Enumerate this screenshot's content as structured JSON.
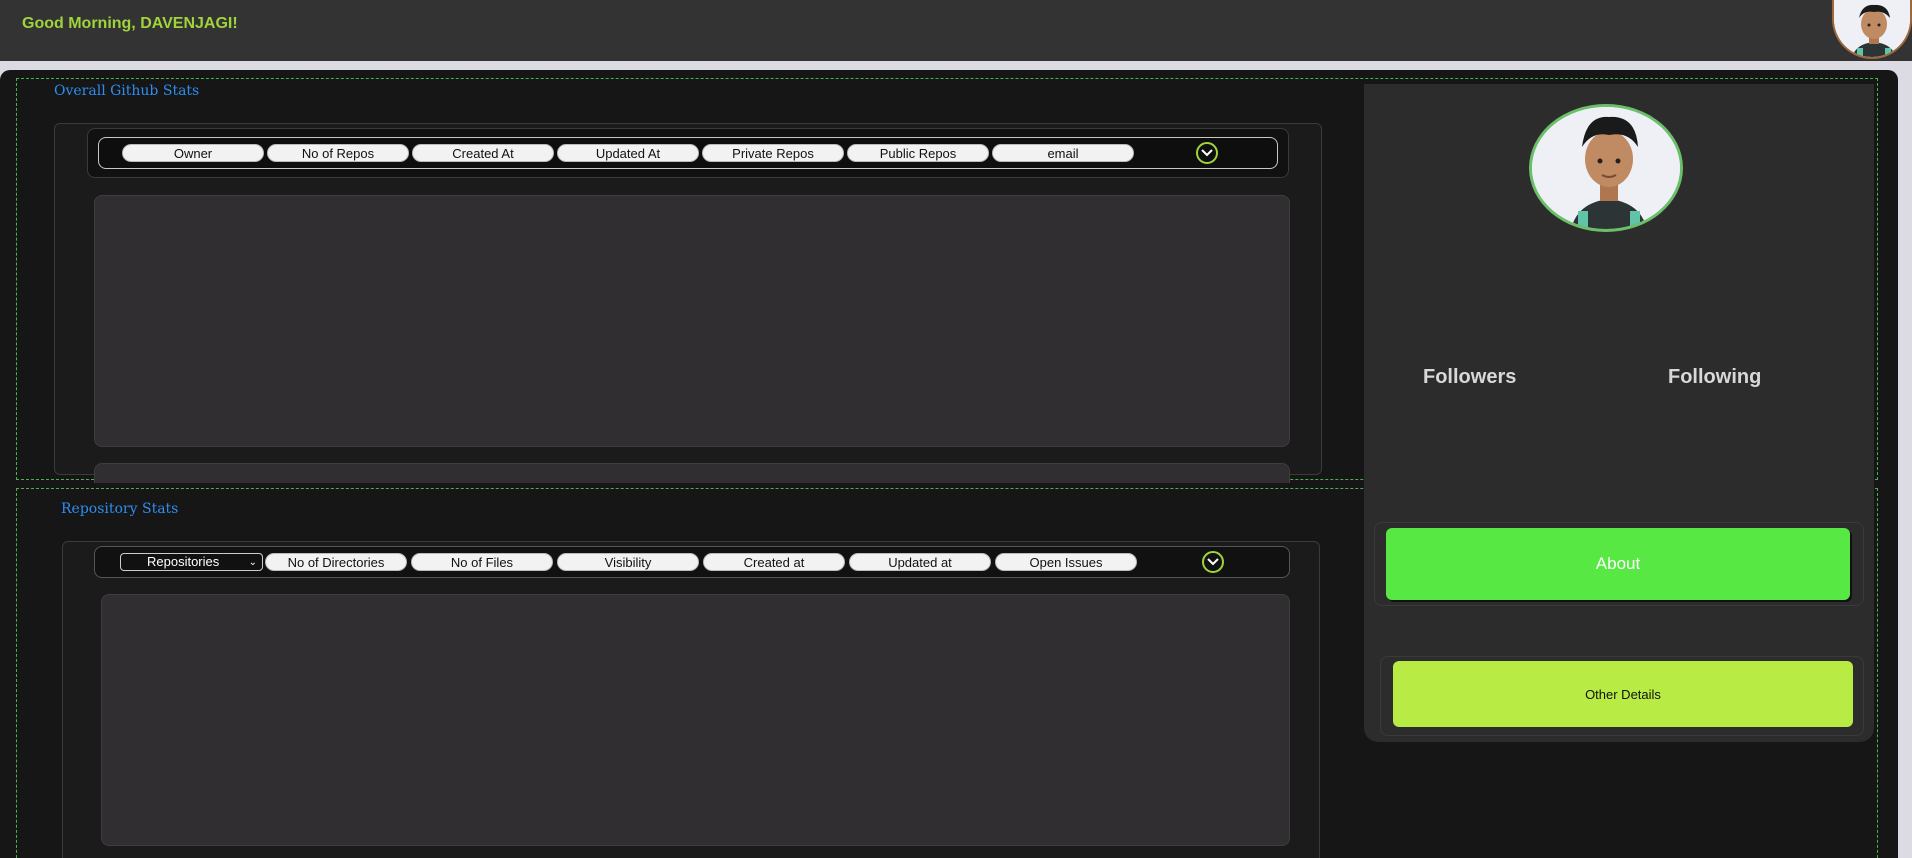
{
  "header": {
    "greeting": "Good Morning, DAVENJAGI!"
  },
  "overall": {
    "title": "Overall Github Stats",
    "columns": [
      "Owner",
      "No of Repos",
      "Created At",
      "Updated At",
      "Private Repos",
      "Public Repos",
      "email"
    ]
  },
  "repository": {
    "title": "Repository Stats",
    "select_value": "Repositories",
    "columns": [
      "No of Directories",
      "No of Files",
      "Visibility",
      "Created at",
      "Updated at",
      "Open Issues"
    ]
  },
  "profile": {
    "followers_label": "Followers",
    "following_label": "Following",
    "about_label": "About",
    "other_details_label": "Other Details"
  },
  "colors": {
    "accent_green": "#57e844",
    "lime": "#b8ec44",
    "greeting": "#9fd43b",
    "title_blue": "#2f8df0"
  }
}
